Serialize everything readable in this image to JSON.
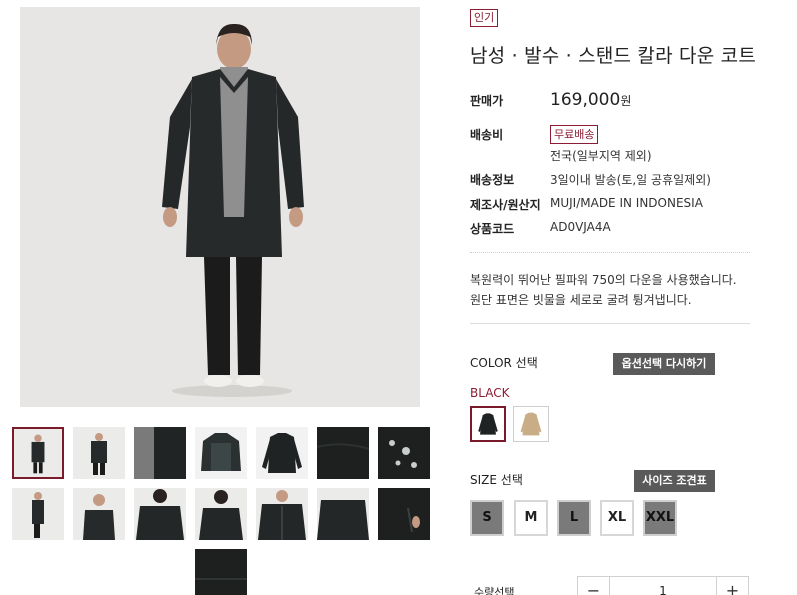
{
  "badges": {
    "popular": "인기",
    "free_shipping": "무료배송"
  },
  "product": {
    "title": "남성 · 발수 · 스탠드 칼라 다운 코트",
    "price_label": "판매가",
    "price": "169,000",
    "currency": "원",
    "shipping_label": "배송비",
    "shipping_note": "전국(일부지역 제외)",
    "delivery_label": "배송정보",
    "delivery_value": "3일이내 발송(토,일 공휴일제외)",
    "maker_label": "제조사/원산지",
    "maker_value": "MUJI/MADE IN INDONESIA",
    "code_label": "상품코드",
    "code_value": "AD0VJA4A",
    "description": [
      "복원력이 뛰어난 필파워 750의 다운을 사용했습니다.",
      "원단 표면은 빗물을 세로로 굴려 튕겨냅니다."
    ]
  },
  "color": {
    "label": "COLOR 선택",
    "reset_button": "옵션선택 다시하기",
    "selected": "BLACK",
    "swatches": [
      {
        "name": "black-coat",
        "color": "#1f2323"
      },
      {
        "name": "beige-coat",
        "color": "#c9ad86"
      }
    ]
  },
  "size": {
    "label": "SIZE 선택",
    "chart_button": "사이즈 조견표",
    "options": [
      {
        "label": "S",
        "available": false
      },
      {
        "label": "M",
        "available": true
      },
      {
        "label": "L",
        "available": false
      },
      {
        "label": "XL",
        "available": true
      },
      {
        "label": "XXL",
        "available": false
      }
    ]
  },
  "quantity": {
    "label": "수량선택",
    "minus": "−",
    "value": "1",
    "plus": "+"
  },
  "colors": {
    "accent": "#8a1d33",
    "dark_button": "#5a5a5a"
  }
}
